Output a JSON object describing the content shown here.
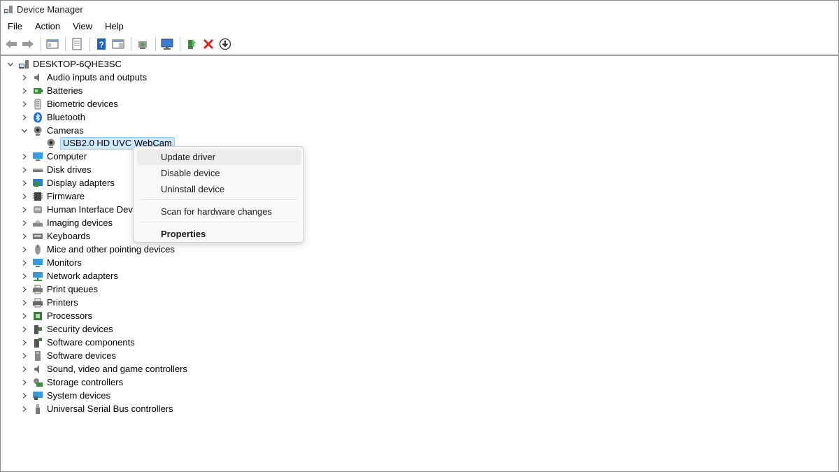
{
  "window": {
    "title": "Device Manager"
  },
  "menubar": [
    "File",
    "Action",
    "View",
    "Help"
  ],
  "toolbar": [
    {
      "icon": "back-arrow-icon"
    },
    {
      "icon": "forward-arrow-icon"
    },
    {
      "icon": "show-hide-console-tree-icon"
    },
    {
      "icon": "properties-sheet-icon"
    },
    {
      "icon": "help-icon"
    },
    {
      "icon": "action-pane-icon"
    },
    {
      "icon": "scan-hardware-icon"
    },
    {
      "icon": "monitor-icon"
    },
    {
      "icon": "update-driver-icon"
    },
    {
      "icon": "uninstall-x-icon"
    },
    {
      "icon": "download-circle-icon"
    }
  ],
  "tree": {
    "root": "DESKTOP-6QHE3SC",
    "categories": [
      {
        "label": "Audio inputs and outputs",
        "icon": "speaker-icon"
      },
      {
        "label": "Batteries",
        "icon": "battery-icon"
      },
      {
        "label": "Biometric devices",
        "icon": "fingerprint-icon"
      },
      {
        "label": "Bluetooth",
        "icon": "bluetooth-icon"
      },
      {
        "label": "Cameras",
        "icon": "camera-icon",
        "expanded": true,
        "children": [
          "USB2.0 HD UVC WebCam"
        ]
      },
      {
        "label": "Computer",
        "icon": "computer-icon"
      },
      {
        "label": "Disk drives",
        "icon": "disk-drive-icon"
      },
      {
        "label": "Display adapters",
        "icon": "display-adapter-icon"
      },
      {
        "label": "Firmware",
        "icon": "firmware-icon"
      },
      {
        "label": "Human Interface Devices",
        "icon": "hid-icon"
      },
      {
        "label": "Imaging devices",
        "icon": "imaging-icon"
      },
      {
        "label": "Keyboards",
        "icon": "keyboard-icon"
      },
      {
        "label": "Mice and other pointing devices",
        "icon": "mouse-icon"
      },
      {
        "label": "Monitors",
        "icon": "monitor-icon"
      },
      {
        "label": "Network adapters",
        "icon": "network-icon"
      },
      {
        "label": "Print queues",
        "icon": "print-queue-icon"
      },
      {
        "label": "Printers",
        "icon": "printer-icon"
      },
      {
        "label": "Processors",
        "icon": "processor-icon"
      },
      {
        "label": "Security devices",
        "icon": "security-icon"
      },
      {
        "label": "Software components",
        "icon": "software-component-icon"
      },
      {
        "label": "Software devices",
        "icon": "software-device-icon"
      },
      {
        "label": "Sound, video and game controllers",
        "icon": "sound-icon"
      },
      {
        "label": "Storage controllers",
        "icon": "storage-icon"
      },
      {
        "label": "System devices",
        "icon": "system-devices-icon"
      },
      {
        "label": "Universal Serial Bus controllers",
        "icon": "usb-icon"
      }
    ]
  },
  "context_menu": {
    "items": [
      "Update driver",
      "Disable device",
      "Uninstall device"
    ],
    "scan": "Scan for hardware changes",
    "properties": "Properties"
  }
}
